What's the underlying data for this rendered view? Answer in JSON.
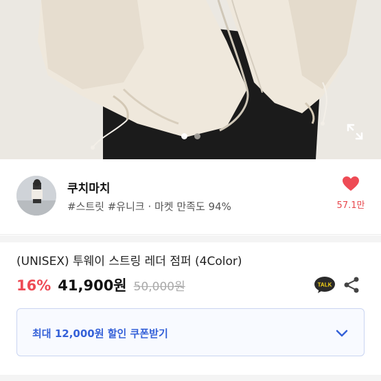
{
  "gallery": {
    "dots_total": 2,
    "active_dot": 1
  },
  "seller": {
    "name": "쿠치마치",
    "meta": "#스트릿 #유니크 · 마켓 만족도 94%",
    "like_count": "57.1만"
  },
  "product": {
    "title": "(UNISEX) 투웨이 스트링 레더 점퍼 (4Color)",
    "discount": "16%",
    "price": "41,900원",
    "original_price": "50,000원"
  },
  "actions": {
    "talk_label": "TALK"
  },
  "coupon": {
    "label": "최대 12,000원 할인 쿠폰받기"
  },
  "colors": {
    "accent_red": "#ee4b55",
    "coupon_blue": "#3561d8"
  }
}
